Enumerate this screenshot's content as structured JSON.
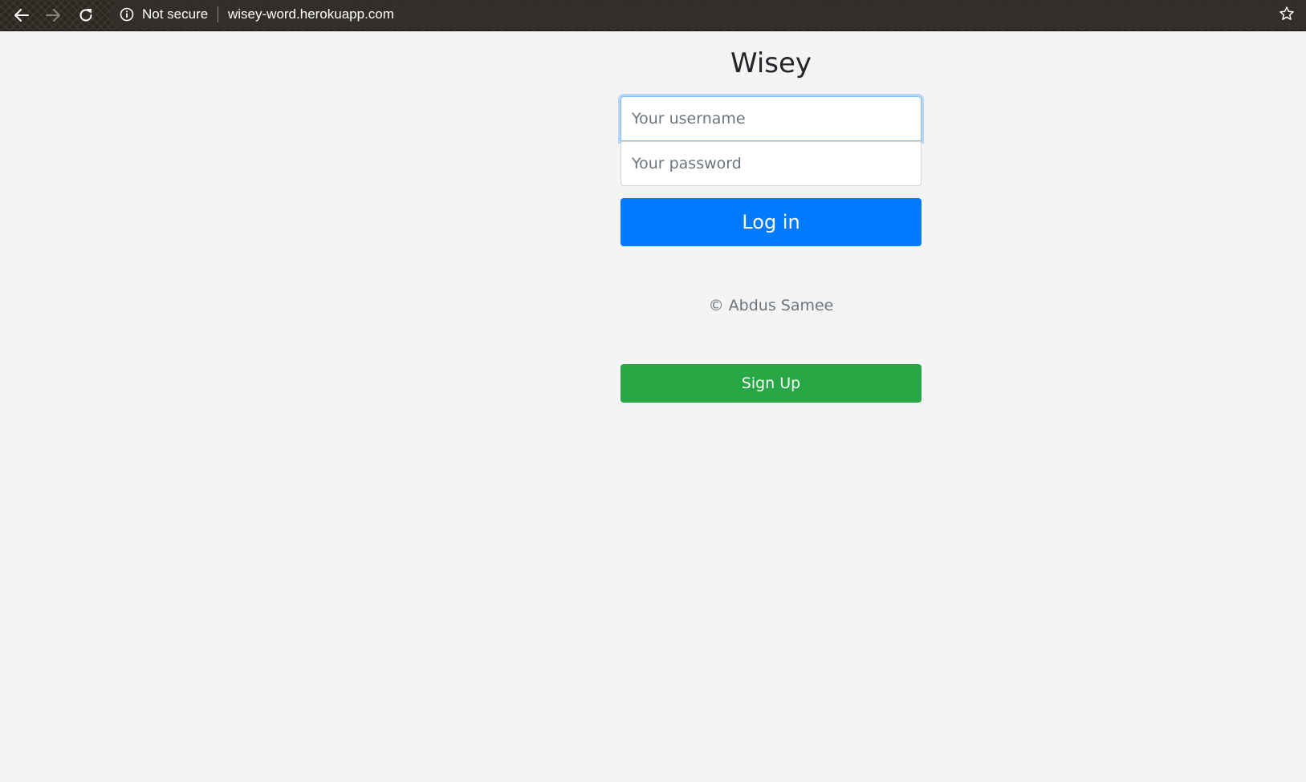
{
  "browser": {
    "back_icon": "arrow-left-icon",
    "forward_icon": "arrow-right-icon",
    "reload_icon": "reload-icon",
    "info_icon": "info-circle-icon",
    "security_label": "Not secure",
    "url": "wisey-word.herokuapp.com",
    "bookmark_icon": "star-icon"
  },
  "login": {
    "title": "Wisey",
    "username_value": "",
    "username_placeholder": "Your username",
    "password_value": "",
    "password_placeholder": "Your password",
    "login_label": "Log in",
    "footer": "© Abdus Samee",
    "signup_label": "Sign Up"
  },
  "colors": {
    "primary": "#007bff",
    "success": "#28a745",
    "background": "#f4f4f4",
    "chrome_bar": "#2b2722"
  }
}
